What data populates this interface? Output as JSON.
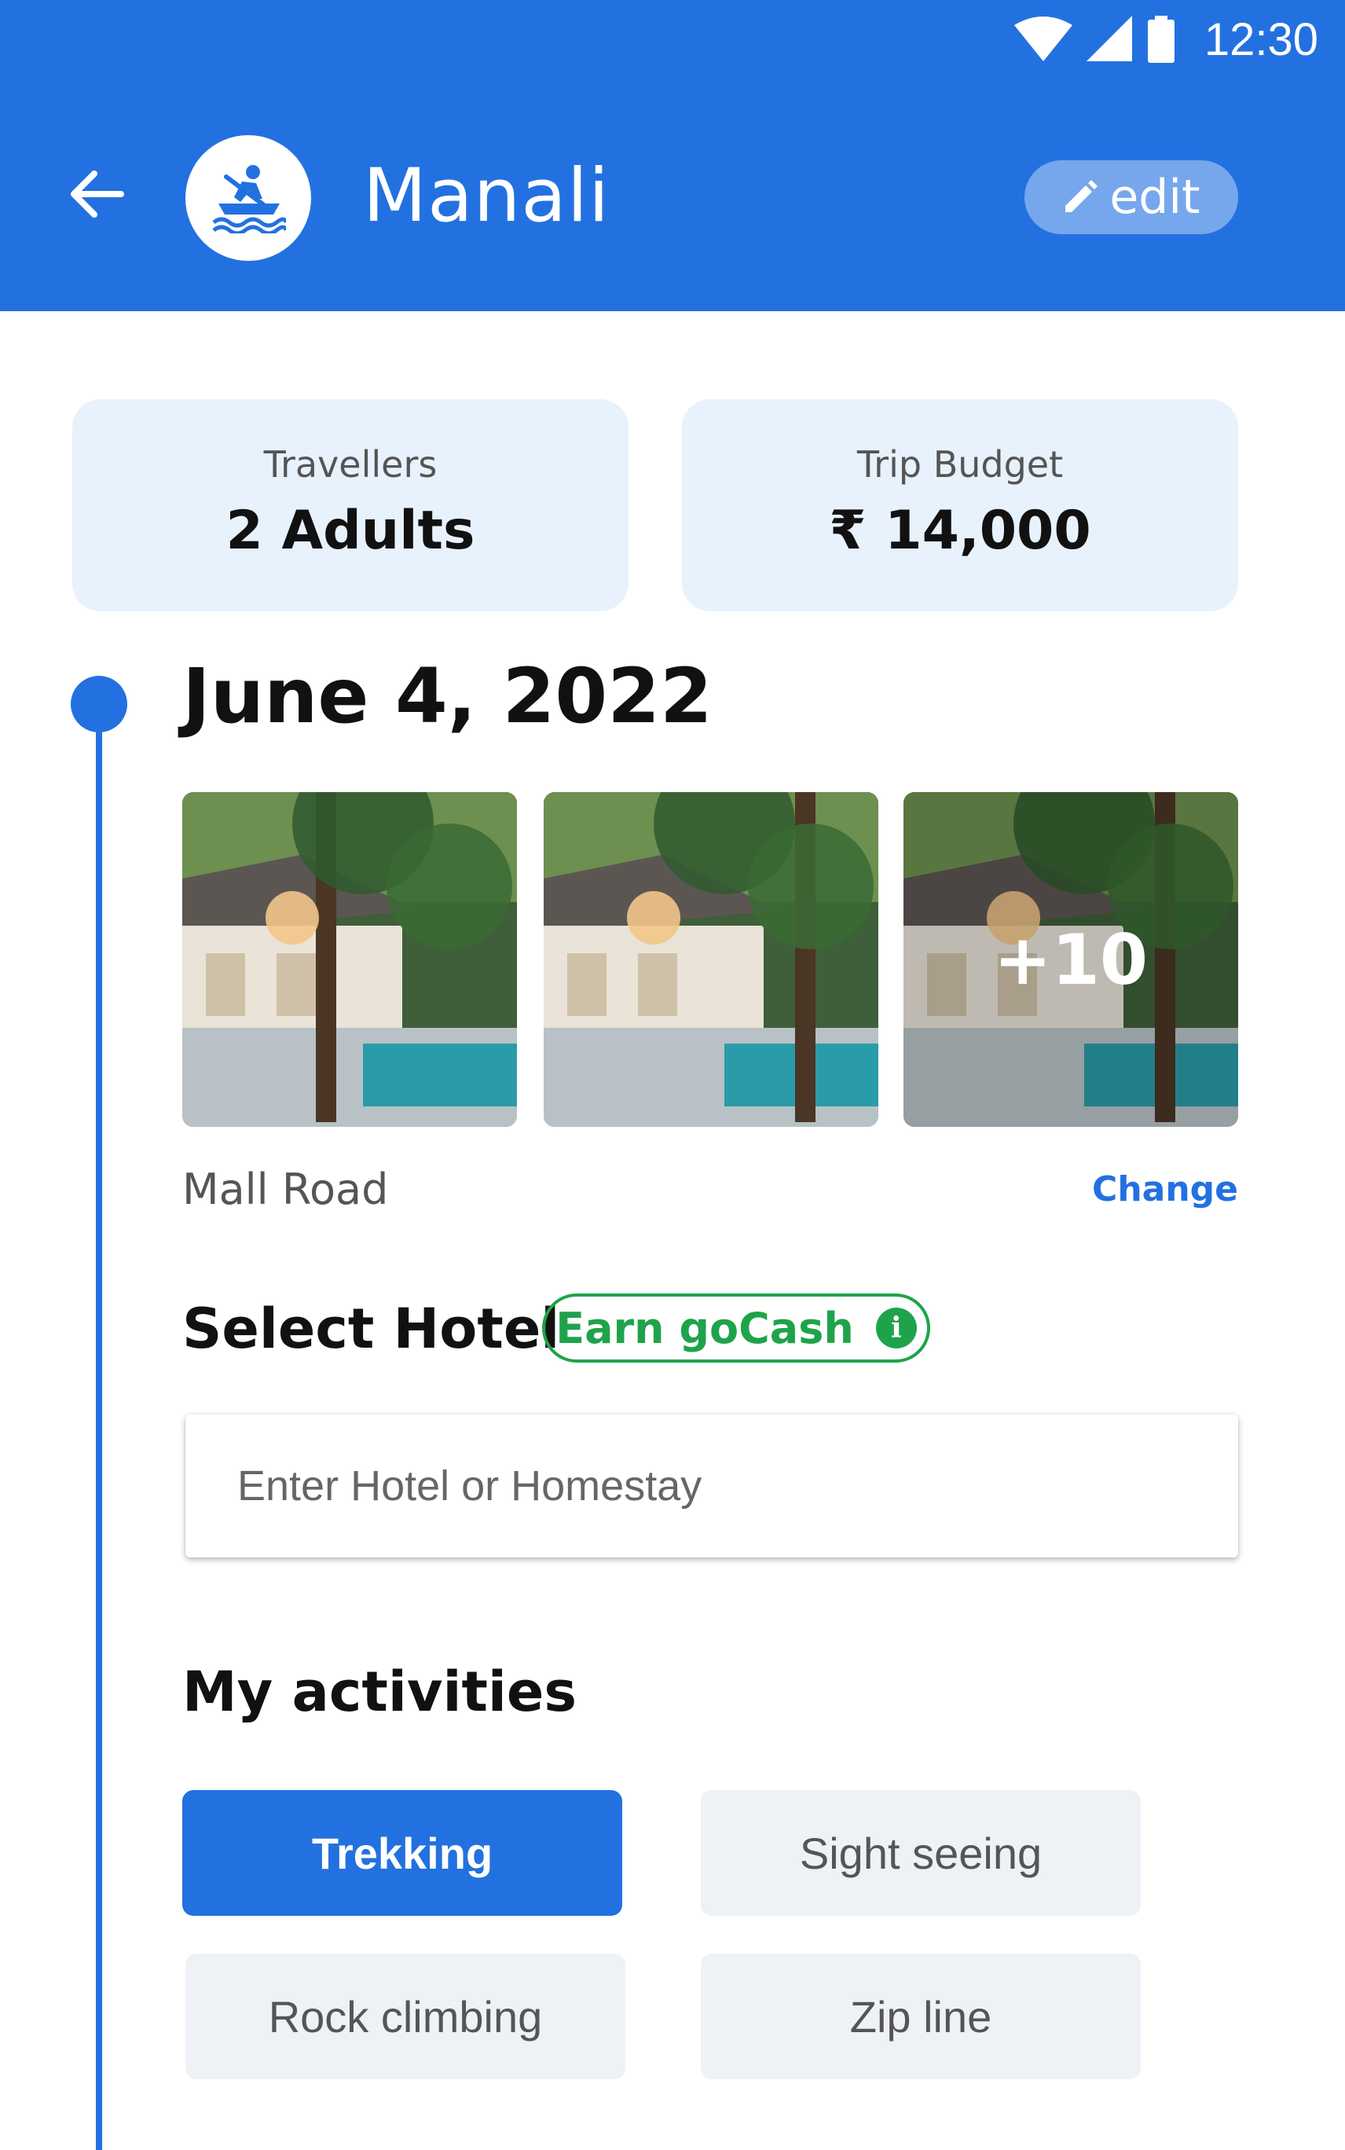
{
  "status_bar": {
    "time": "12:30"
  },
  "header": {
    "title": "Manali",
    "edit_label": "edit"
  },
  "summary": {
    "travellers": {
      "label": "Travellers",
      "value": "2 Adults"
    },
    "budget": {
      "label": "Trip Budget",
      "value": "₹ 14,000"
    }
  },
  "day": {
    "date": "June 4, 2022",
    "photos": {
      "more_count": "+10"
    },
    "place": "Mall Road",
    "change_label": "Change"
  },
  "hotel": {
    "title": "Select Hotel",
    "badge": "Earn goCash",
    "input_placeholder": "Enter Hotel or Homestay"
  },
  "activities": {
    "title": "My activities",
    "items": [
      {
        "label": "Trekking",
        "selected": true
      },
      {
        "label": "Sight seeing",
        "selected": false
      },
      {
        "label": "Rock climbing",
        "selected": false
      },
      {
        "label": "Zip line",
        "selected": false
      }
    ]
  },
  "colors": {
    "primary": "#2371E0",
    "green": "#1FA34A",
    "card_bg": "#E8F2FD",
    "chip_bg": "#EEF2F7"
  }
}
